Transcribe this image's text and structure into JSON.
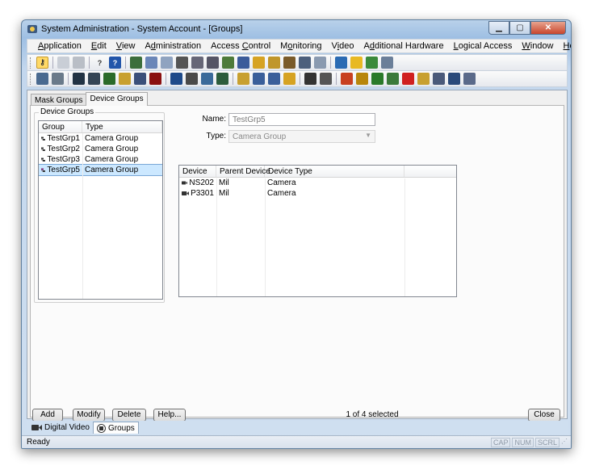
{
  "window": {
    "title": "System Administration - System Account - [Groups]"
  },
  "menu": {
    "items": [
      {
        "label": "Application",
        "key": "A"
      },
      {
        "label": "Edit",
        "key": "E"
      },
      {
        "label": "View",
        "key": "V"
      },
      {
        "label": "Administration",
        "key": "d"
      },
      {
        "label": "Access Control",
        "key": "C"
      },
      {
        "label": "Monitoring",
        "key": "o"
      },
      {
        "label": "Video",
        "key": "i"
      },
      {
        "label": "Additional Hardware",
        "key": "d"
      },
      {
        "label": "Logical Access",
        "key": "L"
      },
      {
        "label": "Window",
        "key": "W"
      },
      {
        "label": "Help",
        "key": "H"
      }
    ],
    "mdi_min": "_",
    "mdi_restore": "🗗",
    "mdi_close": "✕"
  },
  "tabs": {
    "mask_groups": "Mask Groups",
    "device_groups": "Device Groups"
  },
  "groups_panel": {
    "title": "Device Groups",
    "columns": [
      "Group",
      "Type"
    ],
    "rows": [
      {
        "group": "TestGrp1",
        "type": "Camera Group",
        "selected": false
      },
      {
        "group": "TestGrp2",
        "type": "Camera Group",
        "selected": false
      },
      {
        "group": "TestGrp3",
        "type": "Camera Group",
        "selected": false
      },
      {
        "group": "TestGrp5",
        "type": "Camera Group",
        "selected": true
      }
    ]
  },
  "form": {
    "name_label": "Name:",
    "name_value": "TestGrp5",
    "type_label": "Type:",
    "type_value": "Camera Group"
  },
  "devices": {
    "columns": [
      "Device",
      "Parent Device",
      "Device Type"
    ],
    "rows": [
      {
        "device": "NS202",
        "parent": "Mil",
        "type": "Camera"
      },
      {
        "device": "P3301",
        "parent": "Mil",
        "type": "Camera"
      }
    ]
  },
  "buttons": {
    "add": "Add",
    "modify": "Modify",
    "delete": "Delete",
    "help": "Help...",
    "close": "Close"
  },
  "selection_count": "1 of 4 selected",
  "mdi_windows": [
    {
      "label": "Digital Video",
      "active": false
    },
    {
      "label": "Groups",
      "active": true
    }
  ],
  "status": {
    "text": "Ready",
    "indicators": [
      "CAP",
      "NUM",
      "SCRL"
    ]
  }
}
